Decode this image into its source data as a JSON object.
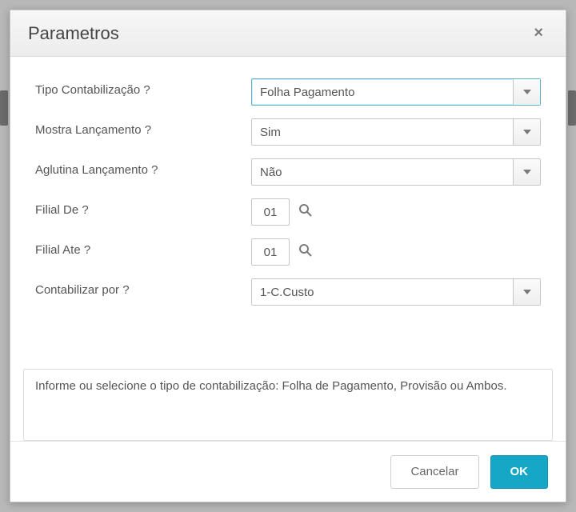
{
  "dialog": {
    "title": "Parametros",
    "close_label": "×"
  },
  "form": {
    "tipo_contabilizacao": {
      "label": "Tipo Contabilização ?",
      "value": "Folha Pagamento"
    },
    "mostra_lancamento": {
      "label": "Mostra Lançamento ?",
      "value": "Sim"
    },
    "aglutina_lancamento": {
      "label": "Aglutina Lançamento ?",
      "value": "Não"
    },
    "filial_de": {
      "label": "Filial De ?",
      "value": "01"
    },
    "filial_ate": {
      "label": "Filial Ate ?",
      "value": "01"
    },
    "contabilizar_por": {
      "label": "Contabilizar por ?",
      "value": "1-C.Custo"
    }
  },
  "help": {
    "text": "Informe ou selecione o tipo de contabilização: Folha de Pagamento, Provisão ou Ambos."
  },
  "footer": {
    "cancel_label": "Cancelar",
    "ok_label": "OK"
  }
}
